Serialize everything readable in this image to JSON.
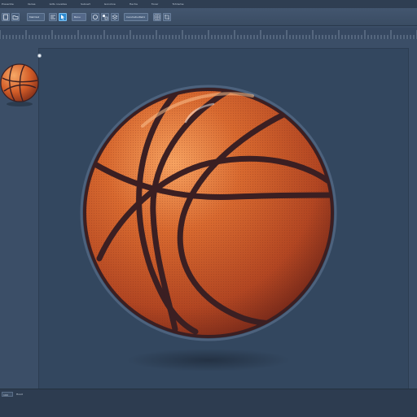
{
  "menu": {
    "items": [
      "Presentie",
      "Ilaries",
      "Gilts novelles",
      "Subowt",
      "Gonolive",
      "Hecha",
      "Tooar",
      "Tohlieme"
    ]
  },
  "toolbar": {
    "font_field": "Metmlst",
    "font_field_2": "Banu",
    "zoom_field": "Ceruhatiudts01"
  },
  "status": {
    "zoom_value": "100",
    "label": "Hood"
  },
  "colors": {
    "accent": "#2f8ad0",
    "canvas": "#33475f",
    "ball": "#c8582a",
    "seam": "#3b1f22"
  }
}
